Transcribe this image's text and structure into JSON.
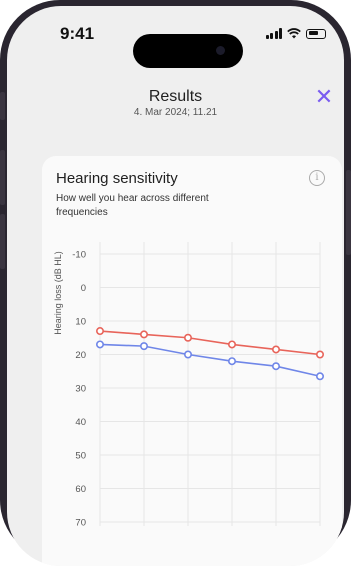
{
  "status_bar": {
    "time": "9:41"
  },
  "header": {
    "title": "Results",
    "date": "4. Mar 2024; 11.21",
    "close_icon": "close-x-icon"
  },
  "card": {
    "title": "Hearing sensitivity",
    "subtitle": "How well you hear across different frequencies",
    "info_icon": "info-icon"
  },
  "colors": {
    "accent": "#7a5cf0",
    "right_ear": "#e8645a",
    "left_ear": "#6f86e8"
  },
  "chart_data": {
    "type": "line",
    "ylabel": "Hearing loss (dB HL)",
    "yticks": [
      -10,
      0,
      10,
      20,
      30,
      40,
      50,
      60,
      70
    ],
    "ylim": [
      -10,
      70
    ],
    "y_inverted": true,
    "grid": true,
    "series": [
      {
        "color": "#e8645a",
        "values": [
          13,
          14,
          15,
          17,
          18.5,
          20
        ]
      },
      {
        "color": "#6f86e8",
        "values": [
          17,
          17.5,
          20,
          22,
          23.5,
          26.5
        ]
      }
    ]
  }
}
